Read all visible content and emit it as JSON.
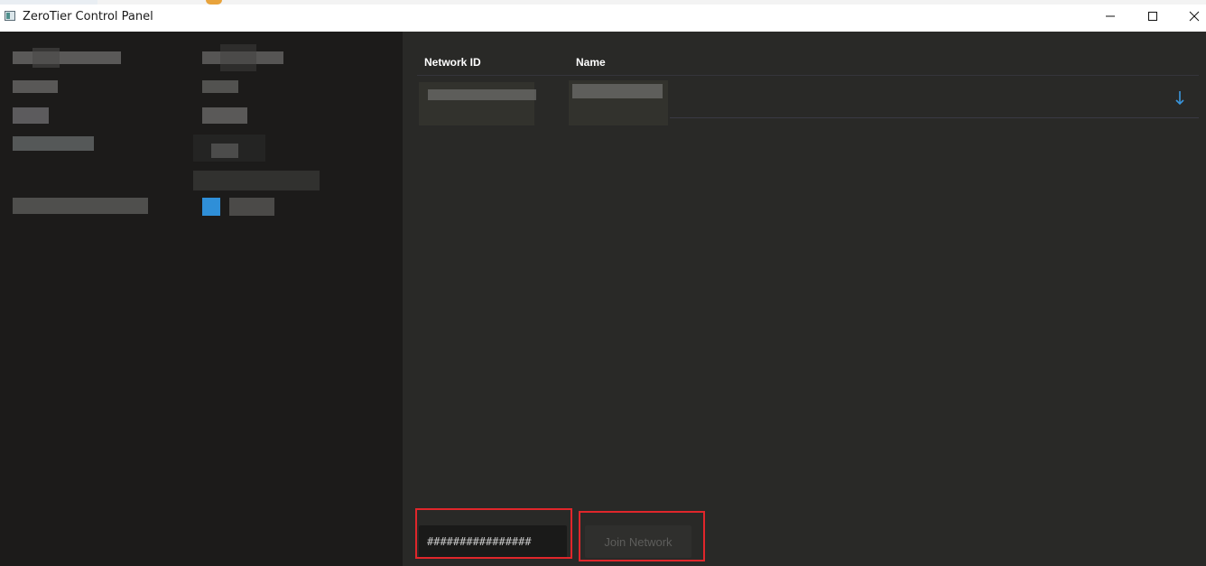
{
  "window": {
    "title": "ZeroTier Control Panel",
    "icons": {
      "app": "app-window-icon",
      "minimize": "minimize-icon",
      "maximize": "maximize-icon",
      "close": "close-icon"
    }
  },
  "network_list": {
    "columns": [
      "Network ID",
      "Name"
    ],
    "row_action_icon": "download-arrow-icon",
    "accent": "#3a96dd"
  },
  "join": {
    "input_value": "################",
    "button_label": "Join Network",
    "highlight_color": "#e0262b"
  },
  "colors": {
    "left_panel": "#1c1b1a",
    "right_panel": "#292927",
    "input_bg": "#1a1a19",
    "button_bg": "#2f2f2d"
  }
}
